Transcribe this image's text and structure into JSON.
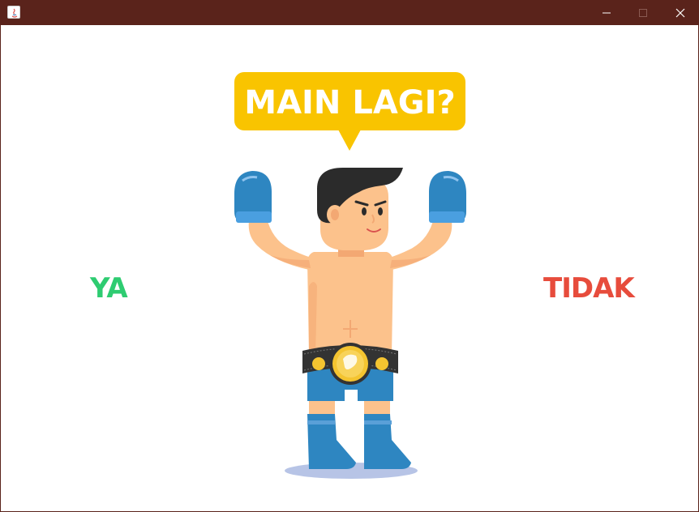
{
  "window": {
    "title": "",
    "titlebar_color": "#5a231b",
    "controls": {
      "minimize_icon": "minimize-icon",
      "maximize_icon": "maximize-icon",
      "close_icon": "close-icon"
    }
  },
  "dialog": {
    "question": "MAIN LAGI?",
    "bubble_color": "#f9c400",
    "yes_label": "YA",
    "yes_color": "#2ecc71",
    "no_label": "TIDAK",
    "no_color": "#e74c3c"
  },
  "illustration": {
    "name": "boxer-champion",
    "glove_color": "#2e86c1",
    "shorts_color": "#2e86c1",
    "belt_color": "#333333",
    "medal_color": "#f4c430"
  }
}
